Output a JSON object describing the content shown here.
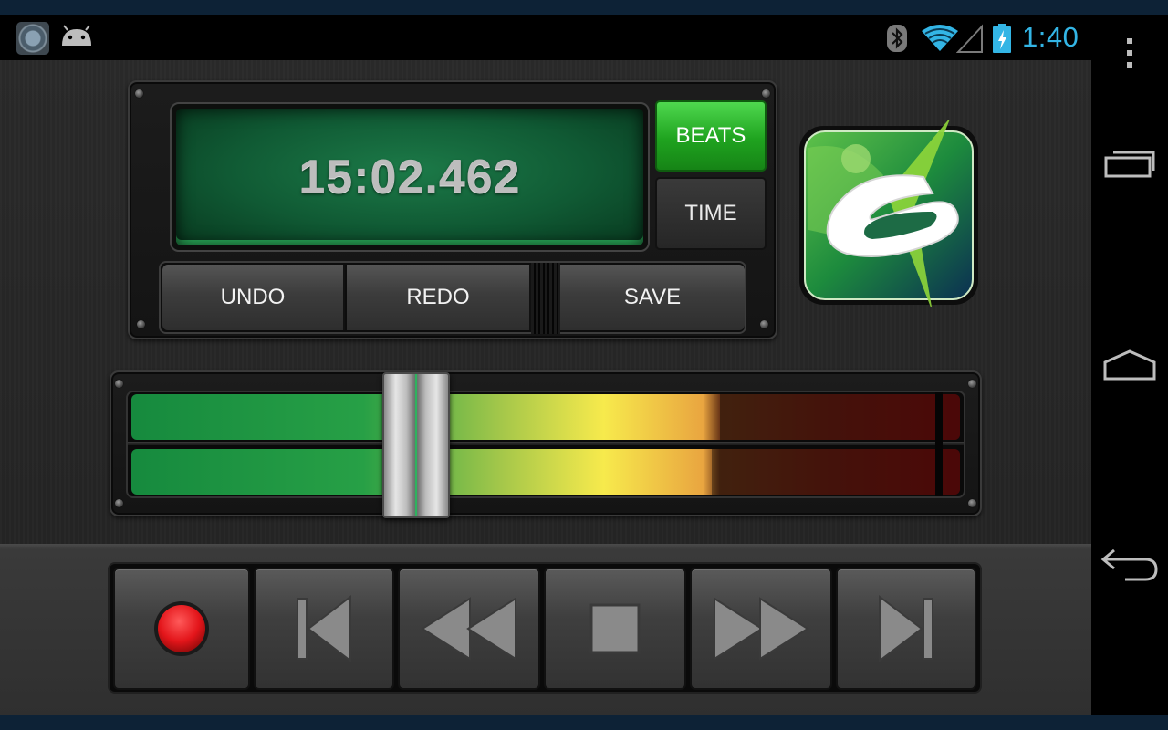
{
  "status_bar": {
    "time": "1:40",
    "icons": [
      "app-icon",
      "android-icon",
      "bluetooth-icon",
      "wifi-icon",
      "signal-icon",
      "battery-charging-icon"
    ]
  },
  "display": {
    "position": "15:02.462"
  },
  "mode": {
    "beats_label": "BEATS",
    "time_label": "TIME",
    "selected": "BEATS"
  },
  "edit": {
    "undo_label": "UNDO",
    "redo_label": "REDO",
    "save_label": "SAVE"
  },
  "meter": {
    "slider_level": 0.33,
    "top_level": 0.71,
    "bottom_level": 0.7,
    "peak_level": 0.97
  },
  "transport": {
    "buttons": [
      "record-icon",
      "skip-to-start-icon",
      "rewind-icon",
      "stop-icon",
      "fast-forward-icon",
      "skip-to-end-icon"
    ]
  },
  "nav": {
    "buttons": [
      "recent-apps-icon",
      "home-icon",
      "back-icon",
      "overflow-menu-icon"
    ]
  },
  "colors": {
    "accent_blue": "#33b5e5",
    "beats_green": "#2cc02c",
    "record_red": "#e3151a"
  }
}
